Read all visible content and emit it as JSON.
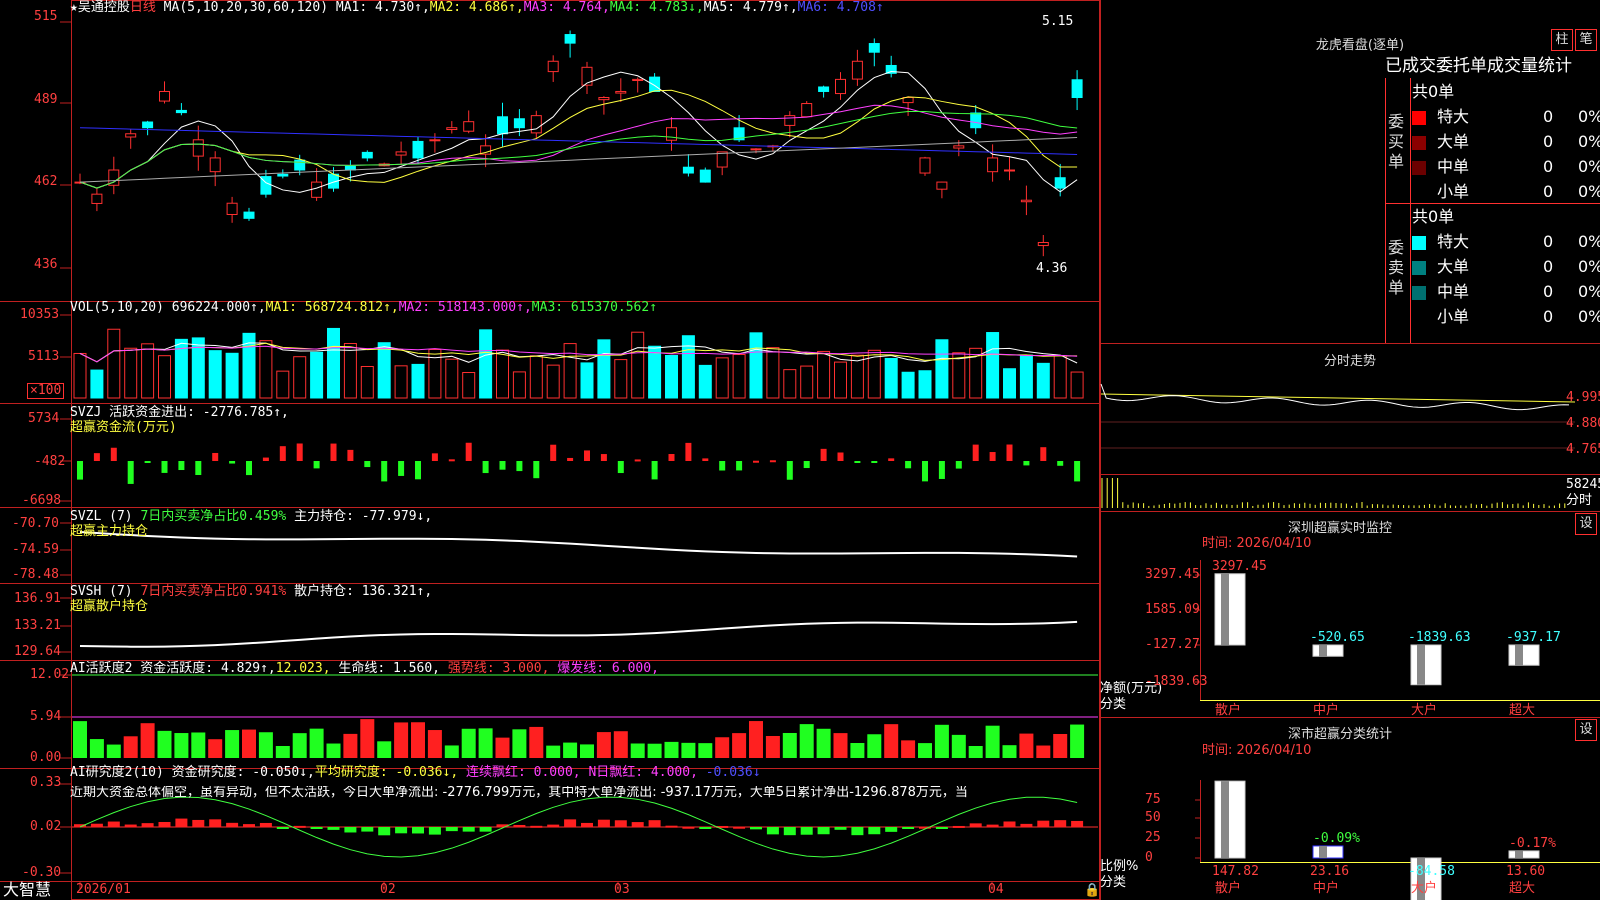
{
  "header": {
    "stock_name": "★吴通控股",
    "period": "日线",
    "ma_label": "MA(5,10,20,30,60,120)",
    "ma1": "MA1: 4.730↑,",
    "ma2": "MA2: 4.686↑,",
    "ma3": "MA3: 4.764,",
    "ma4": "MA4: 4.783↓,",
    "ma5": "MA5: 4.779↑,",
    "ma6": "MA6: 4.708↑"
  },
  "price_axis": [
    "515",
    "489",
    "462",
    "436"
  ],
  "price_marks": {
    "high": "5.15",
    "low": "4.36"
  },
  "vol": {
    "label": "VOL(5,10,20)",
    "value": "696224.000↑,",
    "ma1": "MA1: 568724.812↑,",
    "ma2": "MA2: 518143.000↑,",
    "ma3": "MA3: 615370.562↑",
    "axis": [
      "10353",
      "5113"
    ],
    "unit": "×100"
  },
  "svzj": {
    "label": "SVZJ  活跃资金进出: -2776.785↑,",
    "sub": "超赢资金流(万元)",
    "axis": [
      "5734",
      "-482",
      "-6698"
    ]
  },
  "svzl": {
    "label": "SVZL (7)",
    "ratio": "7日内买卖净占比0.459%",
    "hold": "主力持仓: -77.979↓,",
    "sub": "超赢主力持仓",
    "axis": [
      "-70.70",
      "-74.59",
      "-78.48"
    ]
  },
  "svsh": {
    "label": "SVSH (7)",
    "ratio": "7日内买卖净占比0.941%",
    "hold": "散户持仓: 136.321↑,",
    "sub": "超赢散户持仓",
    "axis": [
      "136.91",
      "133.21",
      "129.64"
    ]
  },
  "ai_active": {
    "label": "AI活跃度2 资金活跃度: 4.829↑,",
    "v2": "12.023,",
    "life": "生命线: 1.560,",
    "strong": "强势线: 3.000,",
    "burst": "爆发线: 6.000,",
    "axis": [
      "12.02",
      "5.94",
      "0.00"
    ]
  },
  "ai_research": {
    "label": "AI研究度2(10) 资金研究度: -0.050↓,",
    "avg": "平均研究度: -0.036↓,",
    "red": "连续飘红: 0.000,",
    "nred": "N日飘红: 4.000,",
    "v": "-0.036↓",
    "comment": "近期大资金总体偏空，虽有异动，但不太活跃，今日大单净流出: -2776.799万元，其中特大单净流出: -937.17万元，大单5日累计净出-1296.878万元，当",
    "axis": [
      "0.33",
      "0.02",
      "-0.30"
    ]
  },
  "date_axis": [
    "2026/01",
    "02",
    "03",
    "04"
  ],
  "brand": "大智慧",
  "right": {
    "dragon_title": "龙虎看盘(逐单)",
    "btn1": "柱",
    "btn2": "笔",
    "tabs": "已成交委托单成交量统计",
    "buy_side": "委买单",
    "sell_side": "委卖单",
    "buy_total": "共0单",
    "sell_total": "共0单",
    "buy_rows": [
      {
        "name": "特大",
        "n": "0",
        "p": "0%",
        "color": "#ff0000"
      },
      {
        "name": "大单",
        "n": "0",
        "p": "0%",
        "color": "#8b0000"
      },
      {
        "name": "中单",
        "n": "0",
        "p": "0%",
        "color": "#6b0000"
      },
      {
        "name": "小单",
        "n": "0",
        "p": "0%",
        "color": ""
      }
    ],
    "sell_rows": [
      {
        "name": "特大",
        "n": "0",
        "p": "0%",
        "color": "#00ffff"
      },
      {
        "name": "大单",
        "n": "0",
        "p": "0%",
        "color": "#008080"
      },
      {
        "name": "中单",
        "n": "0",
        "p": "0%",
        "color": "#007070"
      },
      {
        "name": "小单",
        "n": "0",
        "p": "0%",
        "color": ""
      }
    ],
    "intraday_title": "分时走势",
    "intraday_axis": [
      "4.995",
      "4.880",
      "4.765"
    ],
    "intraday_vol": "58245",
    "intraday_label": "分时",
    "sz_monitor_title": "深圳超赢实时监控",
    "sz_set": "设",
    "sz_time": "时间: 2026/04/10",
    "sz_axis": [
      "3297.45",
      "1585.09",
      "-127.27",
      "-1839.63"
    ],
    "sz_unit": "净额(万元)",
    "sz_class": "分类",
    "sz_bars": [
      {
        "cat": "散户",
        "value": 3297.45,
        "label": "3297.45"
      },
      {
        "cat": "中户",
        "value": -520.65,
        "label": "-520.65"
      },
      {
        "cat": "大户",
        "value": -1839.63,
        "label": "-1839.63"
      },
      {
        "cat": "超大",
        "value": -937.17,
        "label": "-937.17"
      }
    ],
    "cls_title": "深市超赢分类统计",
    "cls_set": "设",
    "cls_time": "时间: 2026/04/10",
    "cls_axis": [
      "75",
      "50",
      "25",
      "0"
    ],
    "cls_unit": "比例%",
    "cls_class": "分类",
    "cls_bars": [
      {
        "cat": "散户",
        "value": 147.82,
        "label": "147.82",
        "top": ""
      },
      {
        "cat": "中户",
        "value": 23.16,
        "label": "23.16",
        "top": "-0.09%"
      },
      {
        "cat": "大户",
        "value": -84.58,
        "label": "-84.58",
        "top": ""
      },
      {
        "cat": "超大",
        "value": 13.6,
        "label": "13.60",
        "top": "-0.17%"
      }
    ]
  }
}
